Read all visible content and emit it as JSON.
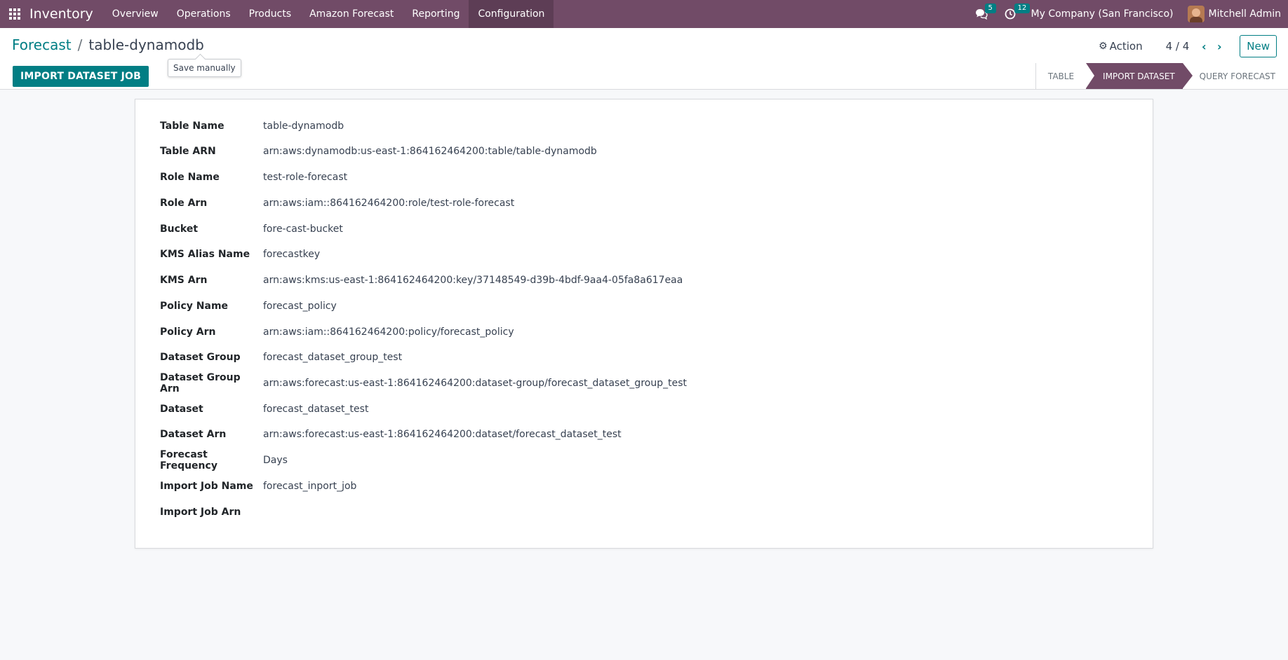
{
  "navbar": {
    "app_name": "Inventory",
    "menu": [
      {
        "label": "Overview"
      },
      {
        "label": "Operations"
      },
      {
        "label": "Products"
      },
      {
        "label": "Amazon Forecast"
      },
      {
        "label": "Reporting"
      },
      {
        "label": "Configuration"
      }
    ],
    "messages_count": "5",
    "activities_count": "12",
    "company": "My Company (San Francisco)",
    "user": "Mitchell Admin"
  },
  "breadcrumb": {
    "parent": "Forecast",
    "separator": "/",
    "current": "table-dynamodb"
  },
  "tooltip": "Save manually",
  "control": {
    "action_label": "Action",
    "pager": "4 / 4",
    "new_label": "New",
    "import_job_label": "IMPORT DATASET JOB"
  },
  "statusbar": [
    {
      "label": "TABLE"
    },
    {
      "label": "IMPORT DATASET"
    },
    {
      "label": "QUERY FORECAST"
    }
  ],
  "fields": [
    {
      "label": "Table Name",
      "value": "table-dynamodb"
    },
    {
      "label": "Table ARN",
      "value": "arn:aws:dynamodb:us-east-1:864162464200:table/table-dynamodb"
    },
    {
      "label": "Role Name",
      "value": "test-role-forecast"
    },
    {
      "label": "Role Arn",
      "value": "arn:aws:iam::864162464200:role/test-role-forecast"
    },
    {
      "label": "Bucket",
      "value": "fore-cast-bucket"
    },
    {
      "label": "KMS Alias Name",
      "value": "forecastkey"
    },
    {
      "label": "KMS Arn",
      "value": "arn:aws:kms:us-east-1:864162464200:key/37148549-d39b-4bdf-9aa4-05fa8a617eaa"
    },
    {
      "label": "Policy Name",
      "value": "forecast_policy"
    },
    {
      "label": "Policy Arn",
      "value": "arn:aws:iam::864162464200:policy/forecast_policy"
    },
    {
      "label": "Dataset Group",
      "value": "forecast_dataset_group_test"
    },
    {
      "label": "Dataset Group Arn",
      "value": "arn:aws:forecast:us-east-1:864162464200:dataset-group/forecast_dataset_group_test"
    },
    {
      "label": "Dataset",
      "value": "forecast_dataset_test"
    },
    {
      "label": "Dataset Arn",
      "value": "arn:aws:forecast:us-east-1:864162464200:dataset/forecast_dataset_test"
    },
    {
      "label": "Forecast Frequency",
      "value": "Days"
    },
    {
      "label": "Import Job Name",
      "value": "forecast_inport_job"
    },
    {
      "label": "Import Job Arn",
      "value": ""
    }
  ]
}
